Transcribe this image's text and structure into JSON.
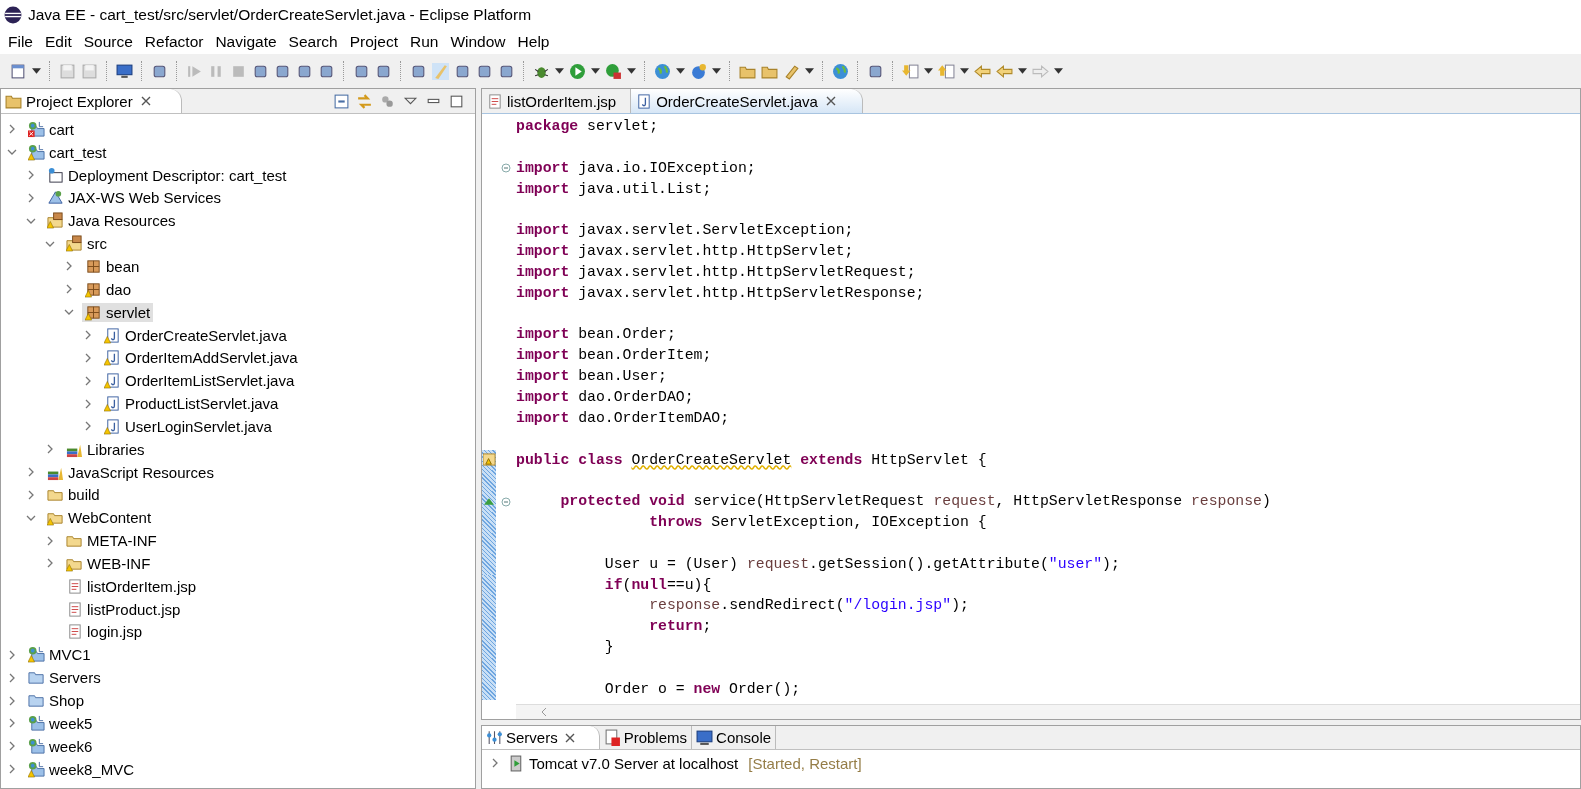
{
  "window": {
    "title": "Java EE - cart_test/src/servlet/OrderCreateServlet.java - Eclipse Platform"
  },
  "menu": [
    "File",
    "Edit",
    "Source",
    "Refactor",
    "Navigate",
    "Search",
    "Project",
    "Run",
    "Window",
    "Help"
  ],
  "project_explorer": {
    "title": "Project Explorer",
    "items": [
      {
        "label": "cart",
        "kind": "project",
        "warning": false,
        "error": true,
        "expanded": false,
        "selected": false
      },
      {
        "label": "cart_test",
        "kind": "project",
        "warning": true,
        "error": false,
        "expanded": true,
        "selected": false,
        "children": [
          {
            "label": "Deployment Descriptor: cart_test",
            "kind": "descriptor",
            "warning": false,
            "error": false,
            "expanded": false,
            "selected": false
          },
          {
            "label": "JAX-WS Web Services",
            "kind": "webservice",
            "warning": false,
            "error": false,
            "expanded": false,
            "selected": false
          },
          {
            "label": "Java Resources",
            "kind": "resources",
            "warning": true,
            "error": false,
            "expanded": true,
            "selected": false,
            "children": [
              {
                "label": "src",
                "kind": "source-folder",
                "warning": true,
                "error": false,
                "expanded": true,
                "selected": false,
                "children": [
                  {
                    "label": "bean",
                    "kind": "package",
                    "warning": false,
                    "error": false,
                    "expanded": false,
                    "selected": false
                  },
                  {
                    "label": "dao",
                    "kind": "package",
                    "warning": true,
                    "error": false,
                    "expanded": false,
                    "selected": false
                  },
                  {
                    "label": "servlet",
                    "kind": "package",
                    "warning": true,
                    "error": false,
                    "expanded": true,
                    "selected": true,
                    "children": [
                      {
                        "label": "OrderCreateServlet.java",
                        "kind": "java-file",
                        "warning": true,
                        "error": false,
                        "expanded": false,
                        "selected": false
                      },
                      {
                        "label": "OrderItemAddServlet.java",
                        "kind": "java-file",
                        "warning": true,
                        "error": false,
                        "expanded": false,
                        "selected": false
                      },
                      {
                        "label": "OrderItemListServlet.java",
                        "kind": "java-file",
                        "warning": true,
                        "error": false,
                        "expanded": false,
                        "selected": false
                      },
                      {
                        "label": "ProductListServlet.java",
                        "kind": "java-file",
                        "warning": true,
                        "error": false,
                        "expanded": false,
                        "selected": false
                      },
                      {
                        "label": "UserLoginServlet.java",
                        "kind": "java-file",
                        "warning": true,
                        "error": false,
                        "expanded": false,
                        "selected": false
                      }
                    ]
                  }
                ]
              },
              {
                "label": "Libraries",
                "kind": "library",
                "warning": false,
                "error": false,
                "expanded": false,
                "selected": false
              }
            ]
          },
          {
            "label": "JavaScript Resources",
            "kind": "library",
            "warning": false,
            "error": false,
            "expanded": false,
            "selected": false
          },
          {
            "label": "build",
            "kind": "folder",
            "warning": false,
            "error": false,
            "expanded": false,
            "selected": false
          },
          {
            "label": "WebContent",
            "kind": "folder",
            "warning": true,
            "error": false,
            "expanded": true,
            "selected": false,
            "children": [
              {
                "label": "META-INF",
                "kind": "folder",
                "warning": false,
                "error": false,
                "expanded": false,
                "selected": false
              },
              {
                "label": "WEB-INF",
                "kind": "folder",
                "warning": true,
                "error": false,
                "expanded": false,
                "selected": false
              },
              {
                "label": "listOrderItem.jsp",
                "kind": "jsp-file",
                "warning": false,
                "error": false,
                "selected": false
              },
              {
                "label": "listProduct.jsp",
                "kind": "jsp-file",
                "warning": false,
                "error": false,
                "selected": false
              },
              {
                "label": "login.jsp",
                "kind": "jsp-file",
                "warning": false,
                "error": false,
                "selected": false
              }
            ]
          }
        ]
      },
      {
        "label": "MVC1",
        "kind": "project",
        "warning": true,
        "error": false,
        "expanded": false,
        "selected": false
      },
      {
        "label": "Servers",
        "kind": "plain-folder",
        "warning": false,
        "error": false,
        "expanded": false,
        "selected": false
      },
      {
        "label": "Shop",
        "kind": "plain-folder",
        "warning": false,
        "error": false,
        "expanded": false,
        "selected": false
      },
      {
        "label": "week5",
        "kind": "project",
        "warning": false,
        "error": false,
        "expanded": false,
        "selected": false
      },
      {
        "label": "week6",
        "kind": "project",
        "warning": false,
        "error": false,
        "expanded": false,
        "selected": false
      },
      {
        "label": "week8_MVC",
        "kind": "project",
        "warning": true,
        "error": false,
        "expanded": false,
        "selected": false
      }
    ]
  },
  "editor": {
    "tabs": [
      {
        "label": "listOrderItem.jsp",
        "kind": "jsp",
        "selected": false
      },
      {
        "label": "OrderCreateServlet.java",
        "kind": "java",
        "selected": true
      }
    ],
    "lines": [
      {
        "in_range": false,
        "tokens": [
          {
            "kind": "kw",
            "t": "package"
          },
          {
            "kind": "plain",
            "t": " servlet;"
          }
        ]
      },
      {
        "in_range": false
      },
      {
        "in_range": false,
        "markers": [
          {
            "kind": "fold"
          }
        ],
        "tokens": [
          {
            "kind": "kw",
            "t": "import"
          },
          {
            "kind": "plain",
            "t": " java.io.IOException;"
          }
        ]
      },
      {
        "in_range": false,
        "tokens": [
          {
            "kind": "kw",
            "t": "import"
          },
          {
            "kind": "plain",
            "t": " java.util.List;"
          }
        ]
      },
      {
        "in_range": false
      },
      {
        "in_range": false,
        "tokens": [
          {
            "kind": "kw",
            "t": "import"
          },
          {
            "kind": "plain",
            "t": " javax.servlet.ServletException;"
          }
        ]
      },
      {
        "in_range": false,
        "tokens": [
          {
            "kind": "kw",
            "t": "import"
          },
          {
            "kind": "plain",
            "t": " javax.servlet.http.HttpServlet;"
          }
        ]
      },
      {
        "in_range": false,
        "tokens": [
          {
            "kind": "kw",
            "t": "import"
          },
          {
            "kind": "plain",
            "t": " javax.servlet.http.HttpServletRequest;"
          }
        ]
      },
      {
        "in_range": false,
        "tokens": [
          {
            "kind": "kw",
            "t": "import"
          },
          {
            "kind": "plain",
            "t": " javax.servlet.http.HttpServletResponse;"
          }
        ]
      },
      {
        "in_range": false
      },
      {
        "in_range": false,
        "tokens": [
          {
            "kind": "kw",
            "t": "import"
          },
          {
            "kind": "plain",
            "t": " bean.Order;"
          }
        ]
      },
      {
        "in_range": false,
        "tokens": [
          {
            "kind": "kw",
            "t": "import"
          },
          {
            "kind": "plain",
            "t": " bean.OrderItem;"
          }
        ]
      },
      {
        "in_range": false,
        "tokens": [
          {
            "kind": "kw",
            "t": "import"
          },
          {
            "kind": "plain",
            "t": " bean.User;"
          }
        ]
      },
      {
        "in_range": false,
        "tokens": [
          {
            "kind": "kw",
            "t": "import"
          },
          {
            "kind": "plain",
            "t": " dao.OrderDAO;"
          }
        ]
      },
      {
        "in_range": false,
        "tokens": [
          {
            "kind": "kw",
            "t": "import"
          },
          {
            "kind": "plain",
            "t": " dao.OrderItemDAO;"
          }
        ]
      },
      {
        "in_range": false
      },
      {
        "in_range": true,
        "markers": [
          {
            "kind": "warning"
          }
        ],
        "tokens": [
          {
            "kind": "kw",
            "t": "public class "
          },
          {
            "kind": "warn",
            "t": "OrderCreateServlet"
          },
          {
            "kind": "kw",
            "t": " extends"
          },
          {
            "kind": "plain",
            "t": " HttpServlet {"
          }
        ]
      },
      {
        "in_range": true
      },
      {
        "in_range": true,
        "markers": [
          {
            "kind": "override"
          },
          {
            "kind": "fold"
          }
        ],
        "tokens": [
          {
            "kind": "kw",
            "t": "\tprotected void"
          },
          {
            "kind": "plain",
            "t": " service(HttpServletRequest "
          },
          {
            "kind": "param",
            "t": "request"
          },
          {
            "kind": "plain",
            "t": ", HttpServletResponse "
          },
          {
            "kind": "param",
            "t": "response"
          },
          {
            "kind": "plain",
            "t": ")"
          }
        ]
      },
      {
        "in_range": true,
        "tokens": [
          {
            "kind": "kw",
            "t": "\t\t\tthrows"
          },
          {
            "kind": "plain",
            "t": " ServletException, IOException {"
          }
        ]
      },
      {
        "in_range": true
      },
      {
        "in_range": true,
        "tokens": [
          {
            "kind": "plain",
            "t": "\t\tUser u = (User) "
          },
          {
            "kind": "param",
            "t": "request"
          },
          {
            "kind": "plain",
            "t": ".getSession().getAttribute("
          },
          {
            "kind": "str",
            "t": "\"user\""
          },
          {
            "kind": "plain",
            "t": ");"
          }
        ]
      },
      {
        "in_range": true,
        "tokens": [
          {
            "kind": "kw",
            "t": "\t\tif"
          },
          {
            "kind": "plain",
            "t": "("
          },
          {
            "kind": "kw",
            "t": "null"
          },
          {
            "kind": "plain",
            "t": "==u){"
          }
        ]
      },
      {
        "in_range": true,
        "tokens": [
          {
            "kind": "param",
            "t": "\t\t\tresponse"
          },
          {
            "kind": "plain",
            "t": ".sendRedirect("
          },
          {
            "kind": "str",
            "t": "\"/login.jsp\""
          },
          {
            "kind": "plain",
            "t": ");"
          }
        ]
      },
      {
        "in_range": true,
        "tokens": [
          {
            "kind": "kw",
            "t": "\t\t\treturn"
          },
          {
            "kind": "plain",
            "t": ";"
          }
        ]
      },
      {
        "in_range": true,
        "tokens": [
          {
            "kind": "plain",
            "t": "\t\t}"
          }
        ]
      },
      {
        "in_range": true
      },
      {
        "in_range": true,
        "tokens": [
          {
            "kind": "plain",
            "t": "\t\tOrder o = "
          },
          {
            "kind": "kw",
            "t": "new"
          },
          {
            "kind": "plain",
            "t": " Order();"
          }
        ]
      }
    ]
  },
  "bottom_panel": {
    "tabs": [
      {
        "label": "Servers",
        "kind": "servers",
        "selected": true
      },
      {
        "label": "Problems",
        "kind": "problems",
        "selected": false
      },
      {
        "label": "Console",
        "kind": "console",
        "selected": false
      }
    ],
    "servers": [
      {
        "name": "Tomcat v7.0 Server at localhost",
        "status": "[Started, Restart]",
        "expanded": false
      }
    ]
  }
}
